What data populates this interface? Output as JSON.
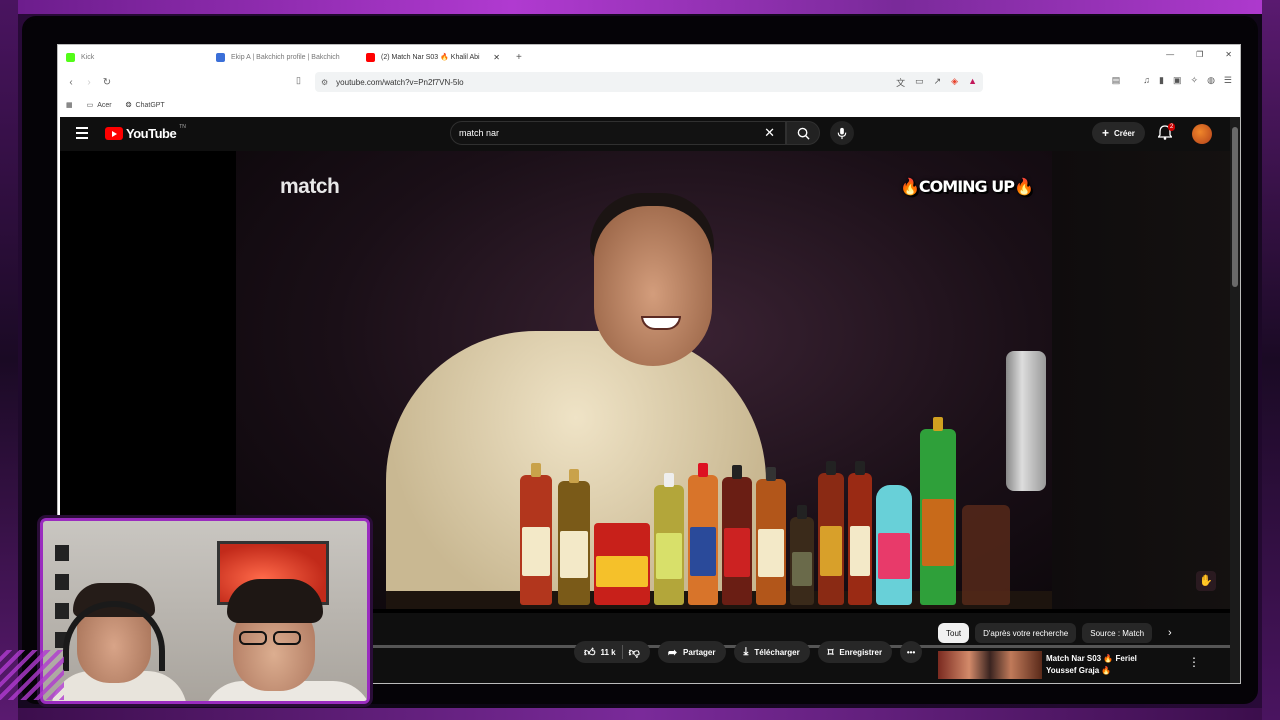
{
  "browser": {
    "tabs": [
      {
        "label": "Kick",
        "favicon_color": "#53fc18"
      },
      {
        "label": "Ekip A | Bakchich profile | Bakchich",
        "favicon_color": "#3b6fd8"
      },
      {
        "label": "(2) Match Nar S03 🔥 Khalil Abi",
        "favicon_color": "#ff0000",
        "active": true
      }
    ],
    "new_tab": "+",
    "url": "youtube.com/watch?v=Pn2f7VN-5lo",
    "bookmarks": [
      {
        "label": "Acer",
        "icon": "folder-icon"
      },
      {
        "label": "ChatGPT",
        "icon": "chatgpt-icon"
      }
    ]
  },
  "youtube": {
    "logo_text": "YouTube",
    "logo_region": "TN",
    "search_value": "match nar",
    "create_label": "Créer",
    "notification_count": "2"
  },
  "video": {
    "watermark_left": "match",
    "watermark_right": "🔥COMING UP🔥"
  },
  "actions": {
    "likes": "11 k",
    "share": "Partager",
    "download": "Télécharger",
    "save": "Enregistrer"
  },
  "chips": [
    "Tout",
    "D'après votre recherche",
    "Source : Match"
  ],
  "recommendation": {
    "title_line1": "Match Nar S03 🔥 Feriel",
    "title_line2": "Youssef Graja 🔥"
  },
  "colors": {
    "overlay_accent": "#b03ad0",
    "youtube_red": "#ff0000",
    "yt_background": "#0f0f0f"
  }
}
